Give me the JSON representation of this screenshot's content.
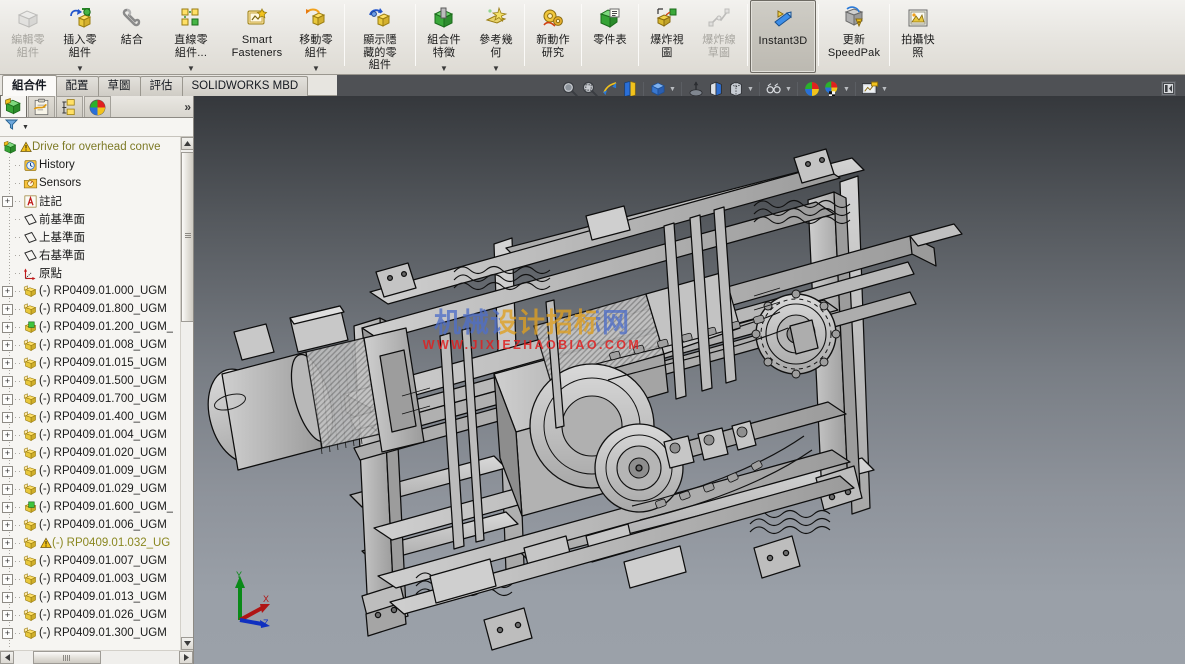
{
  "ribbon": {
    "commands": [
      {
        "label": "編輯零\n組件",
        "icon": "edit-component-icon",
        "disabled": true,
        "dropdown": false,
        "active": false
      },
      {
        "label": "插入零\n組件",
        "icon": "insert-component-icon",
        "disabled": false,
        "dropdown": true,
        "active": false
      },
      {
        "label": "結合",
        "icon": "mate-icon",
        "disabled": false,
        "dropdown": false,
        "active": false
      },
      {
        "label": "直線零\n組件...",
        "icon": "linear-component-pattern-icon",
        "disabled": false,
        "dropdown": true,
        "active": false
      },
      {
        "label": "Smart\nFasteners",
        "icon": "smart-fasteners-icon",
        "disabled": false,
        "dropdown": false,
        "active": false
      },
      {
        "label": "移動零\n組件",
        "icon": "move-component-icon",
        "disabled": false,
        "dropdown": true,
        "active": false
      },
      {
        "sep": true
      },
      {
        "label": "顯示隱\n藏的零\n組件",
        "icon": "show-hidden-components-icon",
        "disabled": false,
        "dropdown": false,
        "active": false
      },
      {
        "sep": true
      },
      {
        "label": "組合件\n特徵",
        "icon": "assembly-features-icon",
        "disabled": false,
        "dropdown": true,
        "active": false
      },
      {
        "label": "參考幾\n何",
        "icon": "reference-geometry-icon",
        "disabled": false,
        "dropdown": true,
        "active": false
      },
      {
        "sep": true
      },
      {
        "label": "新動作\n研究",
        "icon": "new-motion-study-icon",
        "disabled": false,
        "dropdown": false,
        "active": false
      },
      {
        "sep": true
      },
      {
        "label": "零件表",
        "icon": "bill-of-materials-icon",
        "disabled": false,
        "dropdown": false,
        "active": false
      },
      {
        "sep": true
      },
      {
        "label": "爆炸視\n圖",
        "icon": "exploded-view-icon",
        "disabled": false,
        "dropdown": false,
        "active": false
      },
      {
        "label": "爆炸線\n草圖",
        "icon": "explode-line-sketch-icon",
        "disabled": true,
        "dropdown": false,
        "active": false
      },
      {
        "sep": true
      },
      {
        "label": "Instant3D",
        "icon": "instant3d-icon",
        "disabled": false,
        "dropdown": false,
        "active": true
      },
      {
        "sep": true
      },
      {
        "label": "更新\nSpeedPak",
        "icon": "update-speedpak-icon",
        "disabled": false,
        "dropdown": false,
        "active": false
      },
      {
        "sep": true
      },
      {
        "label": "拍攝快\n照",
        "icon": "capture-snapshot-icon",
        "disabled": false,
        "dropdown": false,
        "active": false
      }
    ]
  },
  "tabs": [
    {
      "label": "組合件",
      "selected": true
    },
    {
      "label": "配置",
      "selected": false
    },
    {
      "label": "草圖",
      "selected": false
    },
    {
      "label": "評估",
      "selected": false
    },
    {
      "label": "SOLIDWORKS MBD",
      "selected": false
    }
  ],
  "view_toolbar": {
    "tools": [
      {
        "icon": "zoom-to-fit-icon",
        "caret": false
      },
      {
        "icon": "zoom-to-area-icon",
        "caret": false
      },
      {
        "icon": "previous-view-icon",
        "caret": false
      },
      {
        "icon": "section-view-icon",
        "caret": false
      },
      {
        "sep": true
      },
      {
        "icon": "view-orientation-icon",
        "caret": true
      },
      {
        "sep": true
      },
      {
        "icon": "display-style-isometric-icon",
        "caret": false
      },
      {
        "icon": "display-style-shaded-icon",
        "caret": false
      },
      {
        "icon": "display-style-hidden-lines-icon",
        "caret": true
      },
      {
        "sep": true
      },
      {
        "icon": "hide-show-items-icon",
        "caret": true
      },
      {
        "sep": true
      },
      {
        "icon": "edit-appearance-icon",
        "caret": false
      },
      {
        "icon": "apply-scene-icon",
        "caret": true
      },
      {
        "sep": true
      },
      {
        "icon": "view-settings-icon",
        "caret": true
      }
    ],
    "collapse_panel": "collapse-panel-icon"
  },
  "manager_tabs": [
    {
      "icon": "feature-manager-icon",
      "selected": true
    },
    {
      "icon": "property-manager-icon",
      "selected": false
    },
    {
      "icon": "configuration-manager-icon",
      "selected": false
    },
    {
      "icon": "display-manager-icon",
      "selected": false
    }
  ],
  "manager_more": "»",
  "filter_bar": {
    "icon": "filter-icon",
    "caret": "chevron-down-icon"
  },
  "tree": {
    "root": {
      "label": "Drive for overhead conve",
      "icon": "assembly-icon",
      "warning": true
    },
    "items": [
      {
        "label": "History",
        "icon": "history-icon",
        "expand": false,
        "warning": false
      },
      {
        "label": "Sensors",
        "icon": "sensors-icon",
        "expand": false,
        "warning": false
      },
      {
        "label": "註記",
        "icon": "annotations-icon",
        "expand": true,
        "warning": false
      },
      {
        "label": "前基準面",
        "icon": "plane-icon",
        "expand": false,
        "warning": false
      },
      {
        "label": "上基準面",
        "icon": "plane-icon",
        "expand": false,
        "warning": false
      },
      {
        "label": "右基準面",
        "icon": "plane-icon",
        "expand": false,
        "warning": false
      },
      {
        "label": "原點",
        "icon": "origin-icon",
        "expand": false,
        "warning": false
      },
      {
        "label": "(-) RP0409.01.000_UGM",
        "icon": "component-icon",
        "expand": true,
        "warning": false
      },
      {
        "label": "(-) RP0409.01.800_UGM",
        "icon": "component-icon",
        "expand": true,
        "warning": false
      },
      {
        "label": "(-) RP0409.01.200_UGM_",
        "icon": "component-green-icon",
        "expand": true,
        "warning": false
      },
      {
        "label": "(-) RP0409.01.008_UGM",
        "icon": "component-icon",
        "expand": true,
        "warning": false
      },
      {
        "label": "(-) RP0409.01.015_UGM",
        "icon": "component-icon",
        "expand": true,
        "warning": false
      },
      {
        "label": "(-) RP0409.01.500_UGM",
        "icon": "component-icon",
        "expand": true,
        "warning": false
      },
      {
        "label": "(-) RP0409.01.700_UGM",
        "icon": "component-icon",
        "expand": true,
        "warning": false
      },
      {
        "label": "(-) RP0409.01.400_UGM",
        "icon": "component-icon",
        "expand": true,
        "warning": false
      },
      {
        "label": "(-) RP0409.01.004_UGM",
        "icon": "component-icon",
        "expand": true,
        "warning": false
      },
      {
        "label": "(-) RP0409.01.020_UGM",
        "icon": "component-icon",
        "expand": true,
        "warning": false
      },
      {
        "label": "(-) RP0409.01.009_UGM",
        "icon": "component-icon",
        "expand": true,
        "warning": false
      },
      {
        "label": "(-) RP0409.01.029_UGM",
        "icon": "component-icon",
        "expand": true,
        "warning": false
      },
      {
        "label": "(-) RP0409.01.600_UGM_",
        "icon": "component-green-icon",
        "expand": true,
        "warning": false
      },
      {
        "label": "(-) RP0409.01.006_UGM",
        "icon": "component-icon",
        "expand": true,
        "warning": false
      },
      {
        "label": "(-) RP0409.01.032_UG",
        "icon": "component-icon",
        "expand": true,
        "warning": true
      },
      {
        "label": "(-) RP0409.01.007_UGM",
        "icon": "component-icon",
        "expand": true,
        "warning": false
      },
      {
        "label": "(-) RP0409.01.003_UGM",
        "icon": "component-icon",
        "expand": true,
        "warning": false
      },
      {
        "label": "(-) RP0409.01.013_UGM",
        "icon": "component-icon",
        "expand": true,
        "warning": false
      },
      {
        "label": "(-) RP0409.01.026_UGM",
        "icon": "component-icon",
        "expand": true,
        "warning": false
      },
      {
        "label": "(-) RP0409.01.300_UGM",
        "icon": "component-icon",
        "expand": true,
        "warning": false
      }
    ]
  },
  "viewport": {
    "watermark_cn": "机械设计招标网",
    "watermark_url": "WWW.JIXIEZHAOBIAO.COM",
    "triad": {
      "x": "X",
      "y": "Y",
      "z": "Z"
    },
    "model_name": "overhead-conveyor-drive-assembly"
  },
  "colors": {
    "ribbon_bg": "#e7e5e0",
    "viewport_top": "#35383c",
    "viewport_bottom": "#9ba1a9",
    "warning_text": "#8a8720",
    "watermark_red": "#e02020"
  }
}
